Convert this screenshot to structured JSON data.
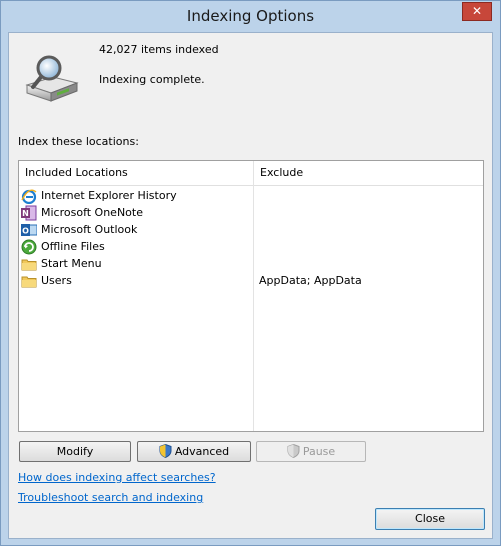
{
  "window": {
    "title": "Indexing Options"
  },
  "status": {
    "items_indexed": "42,027 items indexed",
    "state": "Indexing complete."
  },
  "section_label": "Index these locations:",
  "table": {
    "columns": [
      "Included Locations",
      "Exclude"
    ],
    "rows": [
      {
        "location": "Internet Explorer History",
        "exclude": "",
        "icon": "internet-explorer-icon"
      },
      {
        "location": "Microsoft OneNote",
        "exclude": "",
        "icon": "onenote-icon"
      },
      {
        "location": "Microsoft Outlook",
        "exclude": "",
        "icon": "outlook-icon"
      },
      {
        "location": "Offline Files",
        "exclude": "",
        "icon": "offline-files-icon"
      },
      {
        "location": "Start Menu",
        "exclude": "",
        "icon": "folder-icon"
      },
      {
        "location": "Users",
        "exclude": "AppData; AppData",
        "icon": "folder-icon"
      }
    ]
  },
  "buttons": {
    "modify": "Modify",
    "advanced": "Advanced",
    "pause": "Pause",
    "close": "Close"
  },
  "links": {
    "help": "How does indexing affect searches?",
    "troubleshoot": "Troubleshoot search and indexing"
  }
}
